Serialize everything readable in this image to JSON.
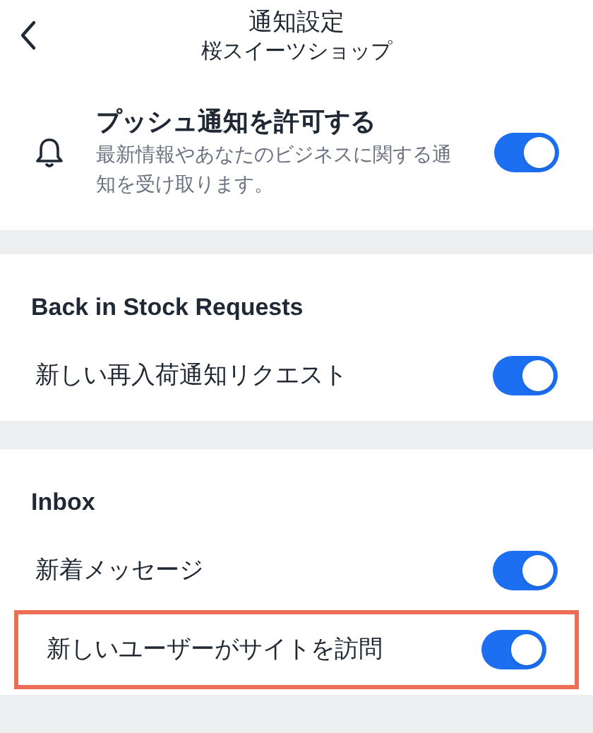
{
  "header": {
    "title": "通知設定",
    "subtitle": "桜スイーツショップ"
  },
  "push": {
    "title": "プッシュ通知を許可する",
    "description": "最新情報やあなたのビジネスに関する通知を受け取ります。",
    "on": true
  },
  "sections": [
    {
      "title": "Back in Stock Requests",
      "items": [
        {
          "label": "新しい再入荷通知リクエスト",
          "on": true,
          "highlighted": false
        }
      ]
    },
    {
      "title": "Inbox",
      "items": [
        {
          "label": "新着メッセージ",
          "on": true,
          "highlighted": false
        },
        {
          "label": "新しいユーザーがサイトを訪問",
          "on": true,
          "highlighted": true
        }
      ]
    }
  ]
}
